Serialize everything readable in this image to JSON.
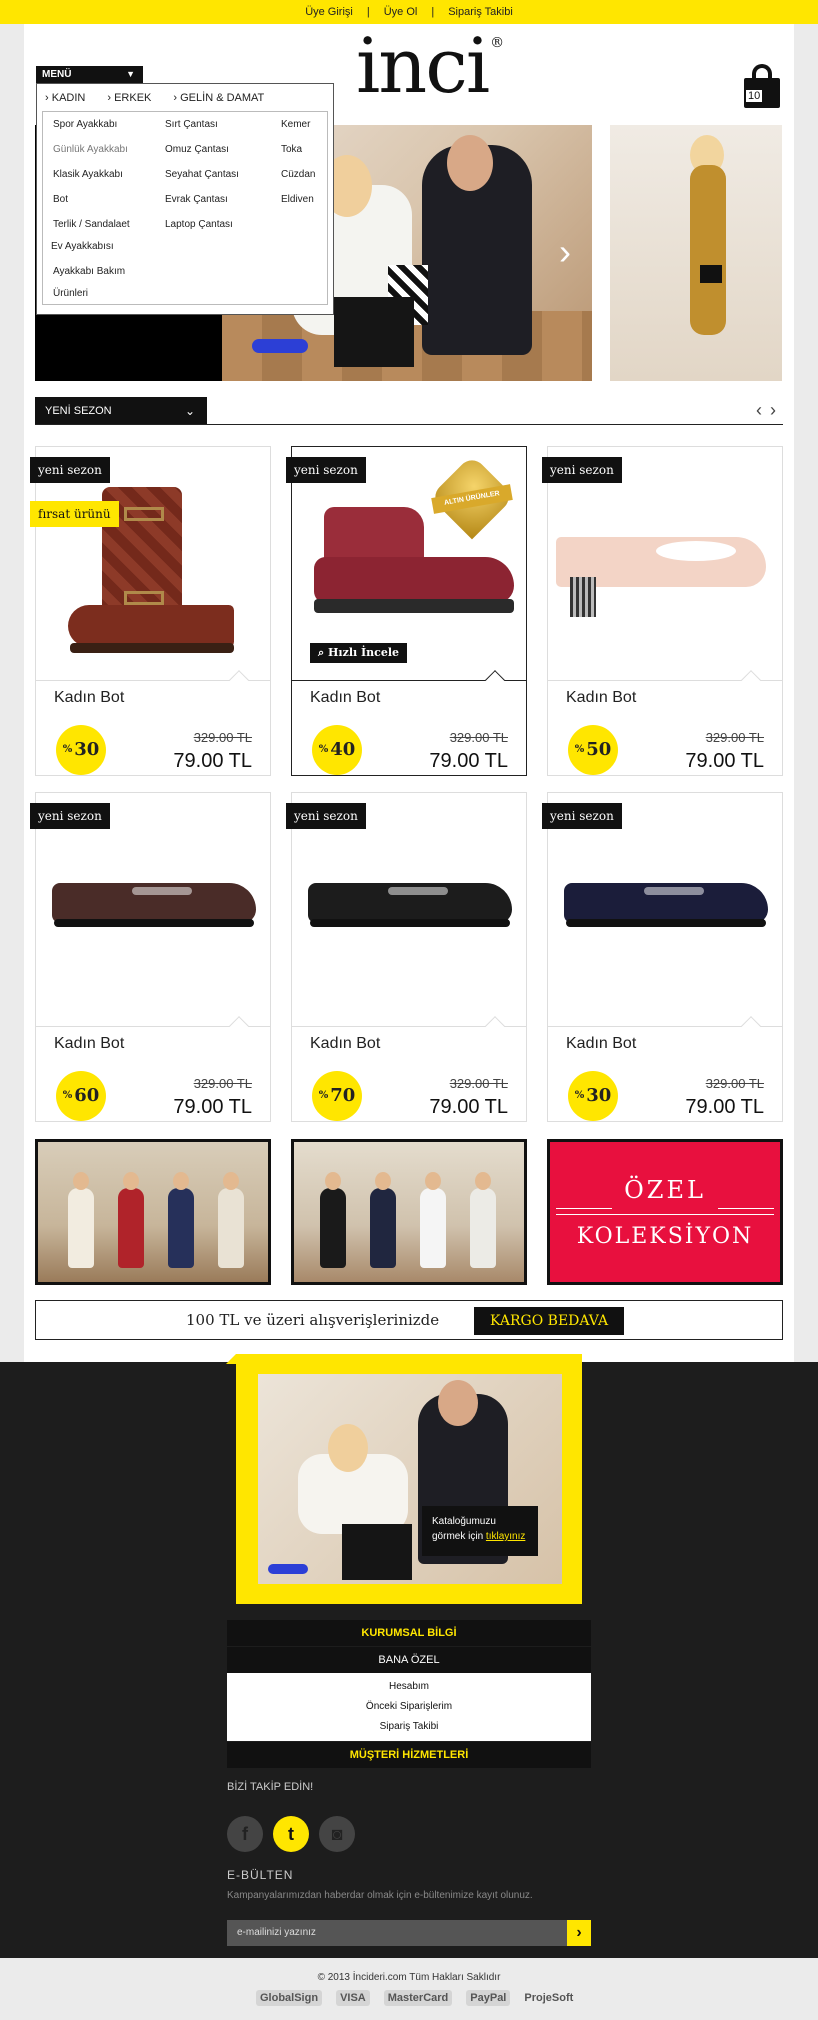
{
  "topbar": {
    "links": [
      "Üye Girişi",
      "Üye Ol",
      "Sipariş Takibi"
    ],
    "sep": "|"
  },
  "brand": {
    "logo": "inci",
    "reg": "®",
    "accent": "#ffe600"
  },
  "cart": {
    "count": "10",
    "icon": "shopping-bag-icon"
  },
  "menu": {
    "button": "MENÜ",
    "top": [
      "KADIN",
      "ERKEK",
      "GELİN & DAMAT"
    ],
    "col1": [
      "Spor Ayakkabı",
      "Günlük Ayakkabı",
      "Klasik Ayakkabı",
      "Bot",
      "Terlik / Sandalaet",
      "Ev Ayakkabısı",
      "Ayakkabı Bakım",
      "Ürünleri"
    ],
    "col2": [
      "Sırt Çantası",
      "Omuz Çantası",
      "Seyahat Çantası",
      "Evrak Çantası",
      "Laptop Çantası"
    ],
    "col3": [
      "Kemer",
      "Toka",
      "Cüzdan",
      "Eldiven"
    ]
  },
  "section": {
    "title": "YENİ SEZON"
  },
  "products": [
    {
      "badge": "yeni sezon",
      "badge2": "fırsat ürünü",
      "name": "Kadın Bot",
      "disc": "30",
      "old": "329.00 TL",
      "price": "79.00 TL"
    },
    {
      "badge": "yeni sezon",
      "quick": "Hızlı İncele",
      "seal": "ALTIN ÜRÜNLER",
      "name": "Kadın Bot",
      "disc": "40",
      "old": "329.00 TL",
      "price": "79.00 TL"
    },
    {
      "badge": "yeni sezon",
      "name": "Kadın Bot",
      "disc": "50",
      "old": "329.00 TL",
      "price": "79.00 TL"
    },
    {
      "badge": "yeni sezon",
      "name": "Kadın Bot",
      "disc": "60",
      "old": "329.00 TL",
      "price": "79.00 TL"
    },
    {
      "badge": "yeni sezon",
      "name": "Kadın Bot",
      "disc": "70",
      "old": "329.00 TL",
      "price": "79.00 TL"
    },
    {
      "badge": "yeni sezon",
      "name": "Kadın Bot",
      "disc": "30",
      "old": "329.00 TL",
      "price": "79.00 TL"
    }
  ],
  "pct": "%",
  "special": {
    "line1": "ÖZEL",
    "line2": "KOLEKSİYON"
  },
  "shipping": {
    "text": "100 TL ve üzeri alışverişlerinizde",
    "tag": "KARGO BEDAVA"
  },
  "catalog": {
    "text": "Kataloğumuzu görmek için",
    "link": "tıklayınız"
  },
  "footer": {
    "kurumsal": "KURUMSAL BİLGİ",
    "bana_ozel": "BANA ÖZEL",
    "account_links": [
      "Hesabım",
      "Önceki Siparişlerim",
      "Sipariş Takibi"
    ],
    "musteri": "MÜŞTERİ HİZMETLERİ",
    "follow": "BİZİ TAKİP EDİN!",
    "social": {
      "facebook": "f",
      "twitter": "t",
      "instagram": "◙"
    },
    "newsletter_title": "E-BÜLTEN",
    "newsletter_desc": "Kampanyalarımızdan haberdar olmak için e-bültenimize kayıt olunuz.",
    "email_placeholder": "e-mailinizi yazınız",
    "copyright": "© 2013 İncideri.com Tüm Hakları Saklıdır",
    "payment_logos": [
      "GlobalSign",
      "VISA",
      "MasterCard",
      "PayPal",
      "ProjeSoft"
    ]
  }
}
